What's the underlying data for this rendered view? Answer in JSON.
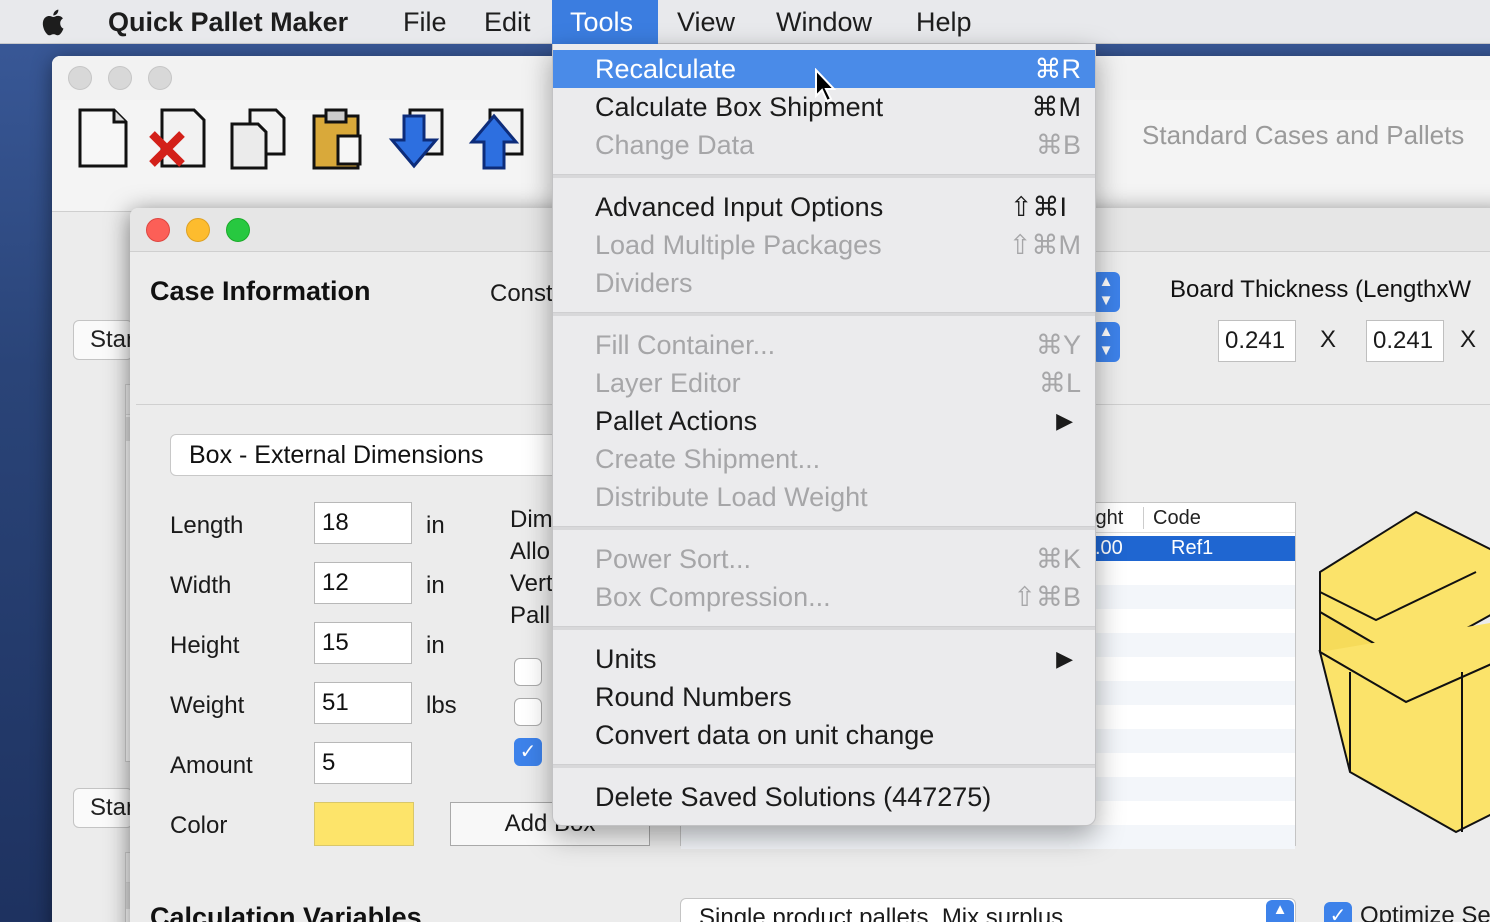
{
  "menubar": {
    "app_name": "Quick Pallet Maker",
    "items": [
      "File",
      "Edit",
      "Tools",
      "View",
      "Window",
      "Help"
    ],
    "active": "Tools"
  },
  "back_window": {
    "title": "Standard Cases and Pallets",
    "button_1": "Standard",
    "button_2": "Standard"
  },
  "case_info": {
    "heading": "Case Information",
    "constraints_label": "Constraints",
    "box_type": "Box - External Dimensions",
    "fields": [
      {
        "label": "Length",
        "value": "18",
        "unit": "in"
      },
      {
        "label": "Width",
        "value": "12",
        "unit": "in"
      },
      {
        "label": "Height",
        "value": "15",
        "unit": "in"
      },
      {
        "label": "Weight",
        "value": "51",
        "unit": "lbs"
      },
      {
        "label": "Amount",
        "value": "5",
        "unit": ""
      }
    ],
    "color_label": "Color",
    "color_value": "#fde46a",
    "add_box_label": "Add Box",
    "side_labels": [
      "Dim",
      "Allo",
      "Vert",
      "Pall"
    ]
  },
  "board": {
    "label": "Board Thickness (LengthxW",
    "length": "0.241",
    "width": "0.241",
    "x": "X"
  },
  "grid": {
    "headers": [
      "ight",
      "Code"
    ],
    "selected_row": [
      ".00",
      "Ref1"
    ]
  },
  "calc": {
    "heading": "Calculation Variables",
    "mode": "Single product pallets, Mix surplus",
    "optimize_label": "Optimize Se"
  },
  "tools_menu": {
    "groups": [
      [
        {
          "label": "Recalculate",
          "shortcut": "⌘R",
          "enabled": true,
          "highlighted": true
        },
        {
          "label": "Calculate Box Shipment",
          "shortcut": "⌘M",
          "enabled": true
        },
        {
          "label": "Change Data",
          "shortcut": "⌘B",
          "enabled": false
        }
      ],
      [
        {
          "label": "Advanced Input Options",
          "shortcut": "⇧⌘I",
          "enabled": true
        },
        {
          "label": "Load Multiple Packages",
          "shortcut": "⇧⌘M",
          "enabled": false
        },
        {
          "label": "Dividers",
          "shortcut": "",
          "enabled": false
        }
      ],
      [
        {
          "label": "Fill Container...",
          "shortcut": "⌘Y",
          "enabled": false
        },
        {
          "label": "Layer Editor",
          "shortcut": "⌘L",
          "enabled": false
        },
        {
          "label": "Pallet Actions",
          "shortcut": "▶",
          "enabled": true,
          "submenu": true
        },
        {
          "label": "Create Shipment...",
          "shortcut": "",
          "enabled": false
        },
        {
          "label": "Distribute Load Weight",
          "shortcut": "",
          "enabled": false
        }
      ],
      [
        {
          "label": "Power Sort...",
          "shortcut": "⌘K",
          "enabled": false
        },
        {
          "label": "Box Compression...",
          "shortcut": "⇧⌘B",
          "enabled": false
        }
      ],
      [
        {
          "label": "Units",
          "shortcut": "▶",
          "enabled": true,
          "submenu": true
        },
        {
          "label": "Round Numbers",
          "shortcut": "",
          "enabled": true
        },
        {
          "label": "Convert data on unit change",
          "shortcut": "",
          "enabled": true
        }
      ],
      [
        {
          "label": "Delete Saved Solutions (447275)",
          "shortcut": "",
          "enabled": true
        }
      ]
    ]
  },
  "colors": {
    "accent": "#3b7de0",
    "highlight": "#4a8be8",
    "box_yellow": "#fde46a"
  },
  "icons": [
    "apple-icon",
    "new-document-icon",
    "delete-document-icon",
    "copy-icon",
    "paste-clipboard-icon",
    "import-arrow-icon",
    "export-arrow-icon",
    "checkmark-icon",
    "submenu-arrow-icon",
    "mouse-cursor-icon",
    "box-3d-icon"
  ]
}
